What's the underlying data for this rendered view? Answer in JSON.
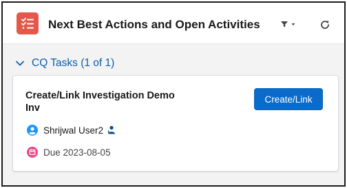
{
  "header": {
    "title": "Next Best Actions and Open Activities",
    "icon": "task-list-icon",
    "accent_color": "#e3584b"
  },
  "toolbar": {
    "filter_icon": "filter-icon",
    "dropdown_icon": "chevron-down-icon",
    "refresh_icon": "refresh-icon"
  },
  "section": {
    "label": "CQ Tasks (1 of 1)",
    "expanded": true
  },
  "card": {
    "title": "Create/Link Investigation Demo Inv",
    "action_label": "Create/Link",
    "owner": "Shrijwal User2",
    "due": "Due 2023-08-05",
    "button_color": "#0b6bcb"
  }
}
